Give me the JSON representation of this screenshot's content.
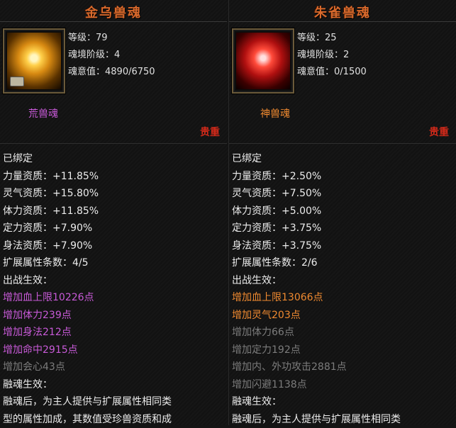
{
  "left": {
    "title": "金乌兽魂",
    "icon": "golden-crow-soul-icon",
    "level_label": "等级：",
    "level": "79",
    "realm_label": "魂境阶级：",
    "realm": "4",
    "intent_label": "魂意值：",
    "intent": "4890/6750",
    "type": "荒兽魂",
    "type_color": "#c85ad8",
    "quality": "贵重",
    "bound": "已绑定",
    "aptitudes": [
      {
        "text": "力量资质：+11.85%"
      },
      {
        "text": "灵气资质：+15.80%"
      },
      {
        "text": "体力资质：+11.85%"
      },
      {
        "text": "定力资质：+7.90%"
      },
      {
        "text": "身法资质：+7.90%"
      },
      {
        "text": "扩展属性条数：4/5"
      }
    ],
    "battle_label": "出战生效：",
    "effects": [
      {
        "text": "增加血上限10226点",
        "state": "active"
      },
      {
        "text": "增加体力239点",
        "state": "active"
      },
      {
        "text": "增加身法212点",
        "state": "active"
      },
      {
        "text": "增加命中2915点",
        "state": "active"
      },
      {
        "text": "增加会心43点",
        "state": "inactive"
      }
    ],
    "fusion_label": "融魂生效：",
    "fusion_lines": [
      "融魂后，为主人提供与扩展属性相同类",
      "型的属性加成，其数值受珍兽资质和成"
    ]
  },
  "right": {
    "title": "朱雀兽魂",
    "icon": "vermilion-bird-soul-icon",
    "level_label": "等级：",
    "level": "25",
    "realm_label": "魂境阶级：",
    "realm": "2",
    "intent_label": "魂意值：",
    "intent": "0/1500",
    "type": "神兽魂",
    "type_color": "#f08a30",
    "quality": "贵重",
    "bound": "已绑定",
    "aptitudes": [
      {
        "text": "力量资质：+2.50%"
      },
      {
        "text": "灵气资质：+7.50%"
      },
      {
        "text": "体力资质：+5.00%"
      },
      {
        "text": "定力资质：+3.75%"
      },
      {
        "text": "身法资质：+3.75%"
      },
      {
        "text": "扩展属性条数：2/6"
      }
    ],
    "battle_label": "出战生效：",
    "effects": [
      {
        "text": "增加血上限13066点",
        "state": "active"
      },
      {
        "text": "增加灵气203点",
        "state": "active"
      },
      {
        "text": "增加体力66点",
        "state": "inactive"
      },
      {
        "text": "增加定力192点",
        "state": "inactive"
      },
      {
        "text": "增加内、外功攻击2881点",
        "state": "inactive"
      },
      {
        "text": "增加闪避1138点",
        "state": "inactive"
      }
    ],
    "fusion_label": "融魂生效：",
    "fusion_lines": [
      "融魂后，为主人提供与扩展属性相同类"
    ]
  }
}
